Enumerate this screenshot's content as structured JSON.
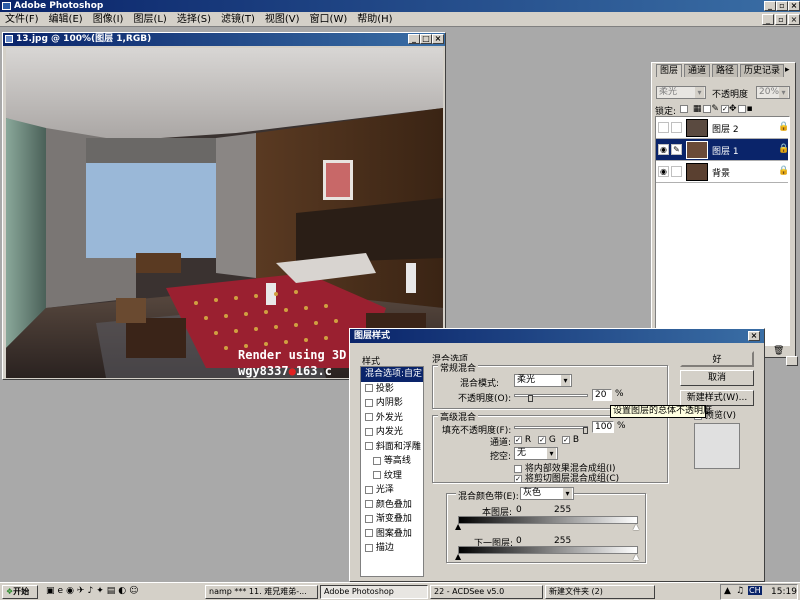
{
  "app": {
    "title": "Adobe Photoshop"
  },
  "menu": [
    "文件(F)",
    "编辑(E)",
    "图像(I)",
    "图层(L)",
    "选择(S)",
    "滤镜(T)",
    "视图(V)",
    "窗口(W)",
    "帮助(H)"
  ],
  "document": {
    "title": "13.jpg @ 100%(图层 1,RGB)",
    "watermark_line1": "Render using 3D",
    "watermark_line2": "wgy8337",
    "watermark_line2_suffix": "163.c"
  },
  "layers_panel": {
    "tabs": [
      "图层",
      "通道",
      "路径",
      "历史记录"
    ],
    "blend_mode": "柔光",
    "opacity_label": "不透明度",
    "opacity_value": "20%",
    "lock_label": "锁定:",
    "layers": [
      {
        "name": "图层 2",
        "selected": false,
        "visible": false
      },
      {
        "name": "图层 1",
        "selected": true,
        "visible": true
      },
      {
        "name": "背景",
        "selected": false,
        "visible": true
      }
    ]
  },
  "dialog": {
    "title": "图层样式",
    "styles_header": "样式",
    "style_items": [
      "混合选项:自定",
      "投影",
      "内阴影",
      "外发光",
      "内发光",
      "斜面和浮雕",
      "等高线",
      "纹理",
      "光泽",
      "颜色叠加",
      "渐变叠加",
      "图案叠加",
      "描边"
    ],
    "blend_options_title": "混合选项",
    "general_blend_title": "常规混合",
    "blend_mode_label": "混合模式:",
    "blend_mode_value": "柔光",
    "opacity_label": "不透明度(O):",
    "opacity_value": "20",
    "percent": "%",
    "advanced_blend_title": "高级混合",
    "fill_opacity_label": "填充不透明度(F):",
    "fill_opacity_value": "100",
    "channels_label": "通道:",
    "channel_r": "R",
    "channel_g": "G",
    "channel_b": "B",
    "knockout_label": "挖空:",
    "knockout_value": "无",
    "option1": "将内部效果混合成组(I)",
    "option2": "将剪切图层混合成组(C)",
    "blend_if_label": "混合颜色带(E):",
    "blend_if_value": "灰色",
    "this_layer_label": "本图层:",
    "underlying_label": "下一图层:",
    "range_min": "0",
    "range_max": "255",
    "ok": "好",
    "cancel": "取消",
    "new_style": "新建样式(W)...",
    "preview": "预览(V)"
  },
  "tooltip": "设置图层的总体不透明度",
  "taskbar": {
    "start": "开始",
    "tasks": [
      "namp *** 11. 难兄难弟-...",
      "Adobe Photoshop",
      "22 - ACDSee v5.0",
      "新建文件夹 (2)"
    ],
    "clock": "15:19",
    "lang": "CH"
  }
}
